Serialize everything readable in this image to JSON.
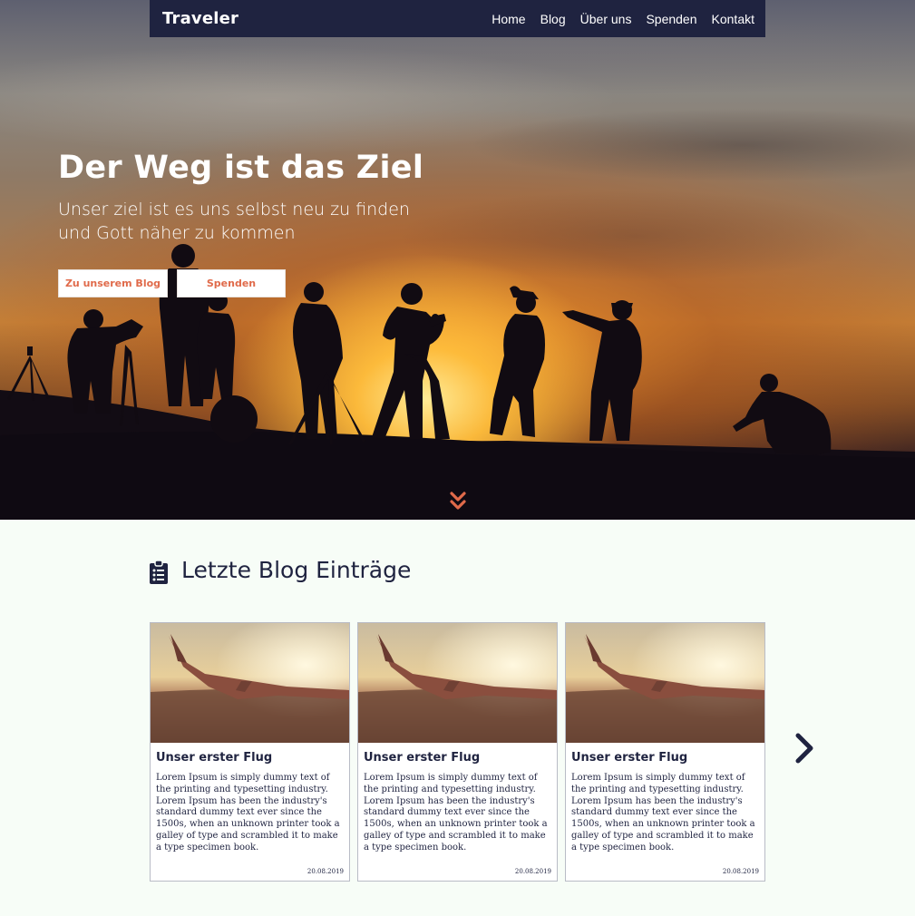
{
  "nav": {
    "brand": "Traveler",
    "links": [
      "Home",
      "Blog",
      "Über uns",
      "Spenden",
      "Kontakt"
    ]
  },
  "hero": {
    "title": "Der Weg ist das Ziel",
    "subtitle": "Unser ziel ist es uns selbst neu zu finden und Gott näher zu kommen",
    "buttons": {
      "blog": "Zu unserem Blog",
      "donate": "Spenden"
    },
    "scroll_icon": "double-chevron-down-icon"
  },
  "blog": {
    "icon": "clipboard-list-icon",
    "heading": "Letzte Blog Einträge",
    "next_icon": "chevron-right-icon",
    "cards": [
      {
        "title": "Unser erster Flug",
        "text": "Lorem Ipsum is simply dummy text of the printing and typesetting industry. Lorem Ipsum has been the industry's standard dummy text ever since the 1500s, when an unknown printer took a galley of type and scrambled it to make a type specimen book.",
        "date": "20.08.2019"
      },
      {
        "title": "Unser erster Flug",
        "text": "Lorem Ipsum is simply dummy text of the printing and typesetting industry. Lorem Ipsum has been the industry's standard dummy text ever since the 1500s, when an unknown printer took a galley of type and scrambled it to make a type specimen book.",
        "date": "20.08.2019"
      },
      {
        "title": "Unser erster Flug",
        "text": "Lorem Ipsum is simply dummy text of the printing and typesetting industry. Lorem Ipsum has been the industry's standard dummy text ever since the 1500s, when an unknown printer took a galley of type and scrambled it to make a type specimen book.",
        "date": "20.08.2019"
      }
    ]
  },
  "colors": {
    "navy": "#1f2340",
    "accent": "#e06a4a",
    "section_bg": "#f7fdf7"
  }
}
